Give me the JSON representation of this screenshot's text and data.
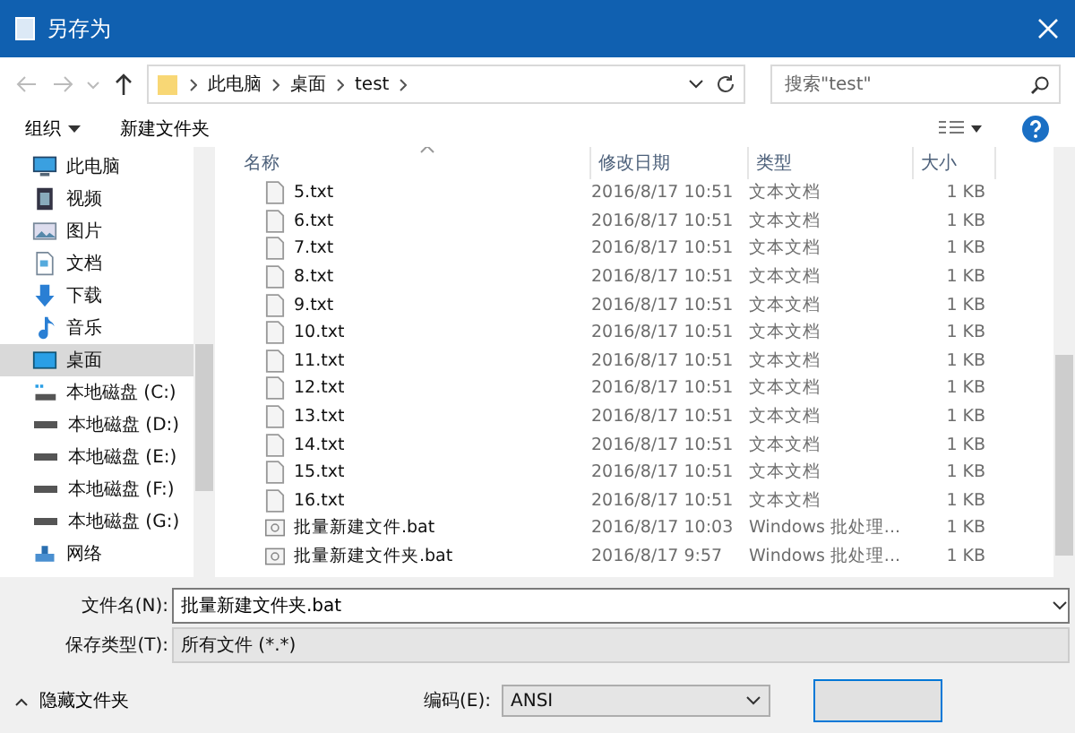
{
  "window": {
    "title": "另存为"
  },
  "address": {
    "breadcrumb": [
      "此电脑",
      "桌面",
      "test"
    ],
    "search_placeholder": "搜索\"test\""
  },
  "toolbar": {
    "organize": "组织",
    "new_folder": "新建文件夹"
  },
  "sidebar": {
    "items": [
      {
        "label": "此电脑",
        "kind": "computer",
        "selected": false
      },
      {
        "label": "视频",
        "kind": "video",
        "selected": false
      },
      {
        "label": "图片",
        "kind": "pictures",
        "selected": false
      },
      {
        "label": "文档",
        "kind": "documents",
        "selected": false
      },
      {
        "label": "下载",
        "kind": "downloads",
        "selected": false
      },
      {
        "label": "音乐",
        "kind": "music",
        "selected": false
      },
      {
        "label": "桌面",
        "kind": "desktop",
        "selected": true
      },
      {
        "label": "本地磁盘 (C:)",
        "kind": "system-drive",
        "selected": false
      },
      {
        "label": "本地磁盘 (D:)",
        "kind": "drive",
        "selected": false
      },
      {
        "label": "本地磁盘 (E:)",
        "kind": "drive",
        "selected": false
      },
      {
        "label": "本地磁盘 (F:)",
        "kind": "drive",
        "selected": false
      },
      {
        "label": "本地磁盘 (G:)",
        "kind": "drive",
        "selected": false
      },
      {
        "label": "网络",
        "kind": "network",
        "selected": false
      }
    ]
  },
  "table": {
    "columns": [
      {
        "label": "名称",
        "sorted": true
      },
      {
        "label": "修改日期"
      },
      {
        "label": "类型"
      },
      {
        "label": "大小"
      }
    ],
    "rows": [
      {
        "name": "5.txt",
        "modified": "2016/8/17 10:51",
        "type": "文本文档",
        "size": "1 KB",
        "kind": "txt"
      },
      {
        "name": "6.txt",
        "modified": "2016/8/17 10:51",
        "type": "文本文档",
        "size": "1 KB",
        "kind": "txt"
      },
      {
        "name": "7.txt",
        "modified": "2016/8/17 10:51",
        "type": "文本文档",
        "size": "1 KB",
        "kind": "txt"
      },
      {
        "name": "8.txt",
        "modified": "2016/8/17 10:51",
        "type": "文本文档",
        "size": "1 KB",
        "kind": "txt"
      },
      {
        "name": "9.txt",
        "modified": "2016/8/17 10:51",
        "type": "文本文档",
        "size": "1 KB",
        "kind": "txt"
      },
      {
        "name": "10.txt",
        "modified": "2016/8/17 10:51",
        "type": "文本文档",
        "size": "1 KB",
        "kind": "txt"
      },
      {
        "name": "11.txt",
        "modified": "2016/8/17 10:51",
        "type": "文本文档",
        "size": "1 KB",
        "kind": "txt"
      },
      {
        "name": "12.txt",
        "modified": "2016/8/17 10:51",
        "type": "文本文档",
        "size": "1 KB",
        "kind": "txt"
      },
      {
        "name": "13.txt",
        "modified": "2016/8/17 10:51",
        "type": "文本文档",
        "size": "1 KB",
        "kind": "txt"
      },
      {
        "name": "14.txt",
        "modified": "2016/8/17 10:51",
        "type": "文本文档",
        "size": "1 KB",
        "kind": "txt"
      },
      {
        "name": "15.txt",
        "modified": "2016/8/17 10:51",
        "type": "文本文档",
        "size": "1 KB",
        "kind": "txt"
      },
      {
        "name": "16.txt",
        "modified": "2016/8/17 10:51",
        "type": "文本文档",
        "size": "1 KB",
        "kind": "txt"
      },
      {
        "name": "批量新建文件.bat",
        "modified": "2016/8/17 10:03",
        "type": "Windows 批处理...",
        "size": "1 KB",
        "kind": "bat"
      },
      {
        "name": "批量新建文件夹.bat",
        "modified": "2016/8/17 9:57",
        "type": "Windows 批处理...",
        "size": "1 KB",
        "kind": "bat"
      }
    ]
  },
  "form": {
    "filename": {
      "label": "文件名(N):",
      "value": "批量新建文件夹.bat"
    },
    "save_type": {
      "label": "保存类型(T):",
      "value": "所有文件 (*.*)"
    }
  },
  "footer": {
    "hide_folders": "隐藏文件夹",
    "encoding": {
      "label": "编码(E):",
      "value": "ANSI"
    }
  }
}
